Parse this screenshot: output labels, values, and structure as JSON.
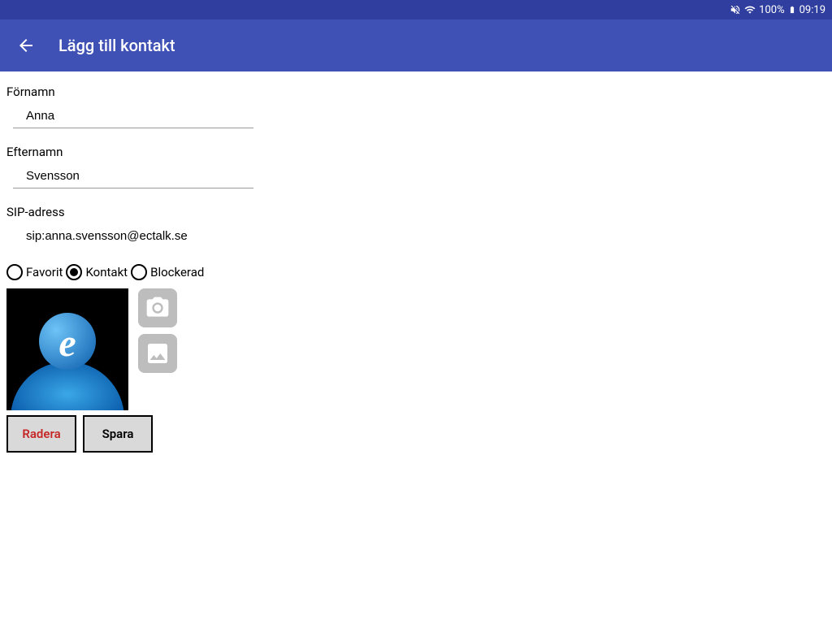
{
  "status": {
    "battery_pct": "100%",
    "time": "09:19"
  },
  "appbar": {
    "title": "Lägg till kontakt"
  },
  "fields": {
    "firstname_label": "Förnamn",
    "firstname_value": "Anna",
    "lastname_label": "Efternamn",
    "lastname_value": "Svensson",
    "sip_label": "SIP-adress",
    "sip_value": "sip:anna.svensson@ectalk.se"
  },
  "radios": {
    "favorite": "Favorit",
    "contact": "Kontakt",
    "blocked": "Blockerad",
    "selected": "contact"
  },
  "buttons": {
    "delete": "Radera",
    "save": "Spara"
  }
}
